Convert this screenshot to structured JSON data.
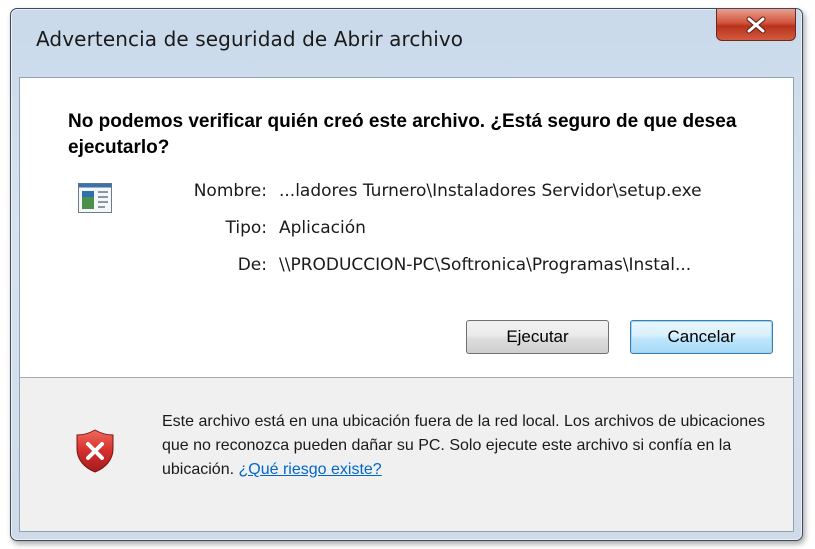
{
  "window": {
    "title": "Advertencia de seguridad de Abrir archivo"
  },
  "dialog": {
    "heading": "No podemos verificar quién creó este archivo. ¿Está seguro de que desea ejecutarlo?",
    "fields": [
      {
        "label": "Nombre:",
        "value": "...ladores Turnero\\Instaladores Servidor\\setup.exe"
      },
      {
        "label": "Tipo:",
        "value": "Aplicación"
      },
      {
        "label": "De:",
        "value": "\\\\PRODUCCION-PC\\Softronica\\Programas\\Instal..."
      }
    ],
    "buttons": {
      "run": "Ejecutar",
      "cancel": "Cancelar"
    }
  },
  "footer": {
    "warning_text": "Este archivo está en una ubicación fuera de la red local. Los archivos de ubicaciones que no reconozca pueden dañar su PC. Solo ejecute este archivo si confía en la ubicación.",
    "risk_link": "¿Qué riesgo existe?"
  },
  "icons": {
    "close": "close-icon",
    "application": "application-icon",
    "security_shield": "shield-error-icon"
  },
  "colors": {
    "close_button": "#c9462c",
    "link": "#0066cc",
    "shield": "#c62828"
  }
}
